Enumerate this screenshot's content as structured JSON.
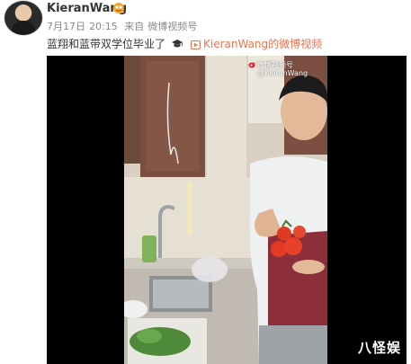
{
  "post": {
    "author": "KieranWang",
    "badge_icon": "gold-badge-icon",
    "date": "7月17日",
    "time": "20:15",
    "source_prefix": "来自",
    "source": "微博视频号",
    "text": "蓝翔和蓝带双学位毕业了",
    "text_icon": "graduation-cap-icon",
    "video_link": "KieranWang的微博视频"
  },
  "video": {
    "watermark_line1": "微博视频号",
    "watermark_line2": "@KieranWang",
    "corner_mark": "八怪娱"
  },
  "colors": {
    "link": "#eb7350",
    "username": "#333333",
    "meta": "#8a8a8a"
  }
}
